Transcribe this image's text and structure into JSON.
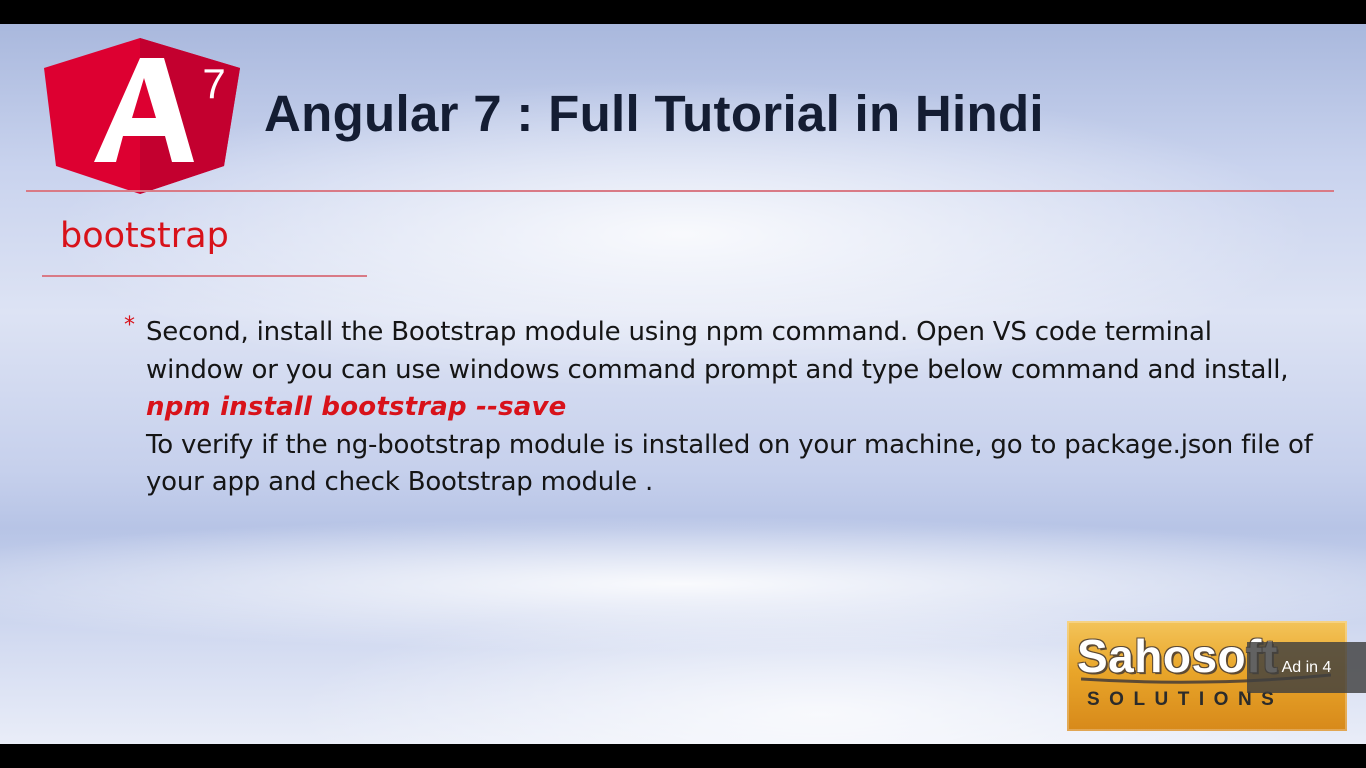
{
  "slide": {
    "logo": {
      "letter": "A",
      "version": "7"
    },
    "title": "Angular 7 : Full Tutorial in Hindi",
    "section_heading": "bootstrap",
    "bullet_marker": "*",
    "paragraph_1": "Second, install the Bootstrap module using npm command. Open VS code terminal window or you can use windows command prompt and type below command and install,",
    "command": "npm install bootstrap --save",
    "paragraph_2": "To verify if the ng-bootstrap module is installed on your machine, go to package.json file of your app and check Bootstrap module ."
  },
  "brand": {
    "name": "Sahosoft",
    "tagline": "SOLUTIONS"
  },
  "ad": {
    "label": "Ad in 4"
  },
  "colors": {
    "accent_red": "#d8121a",
    "title_dark": "#141d33",
    "rule_pink": "#d97a86",
    "angular_red": "#dd0031",
    "brand_orange": "#e9a62a"
  }
}
